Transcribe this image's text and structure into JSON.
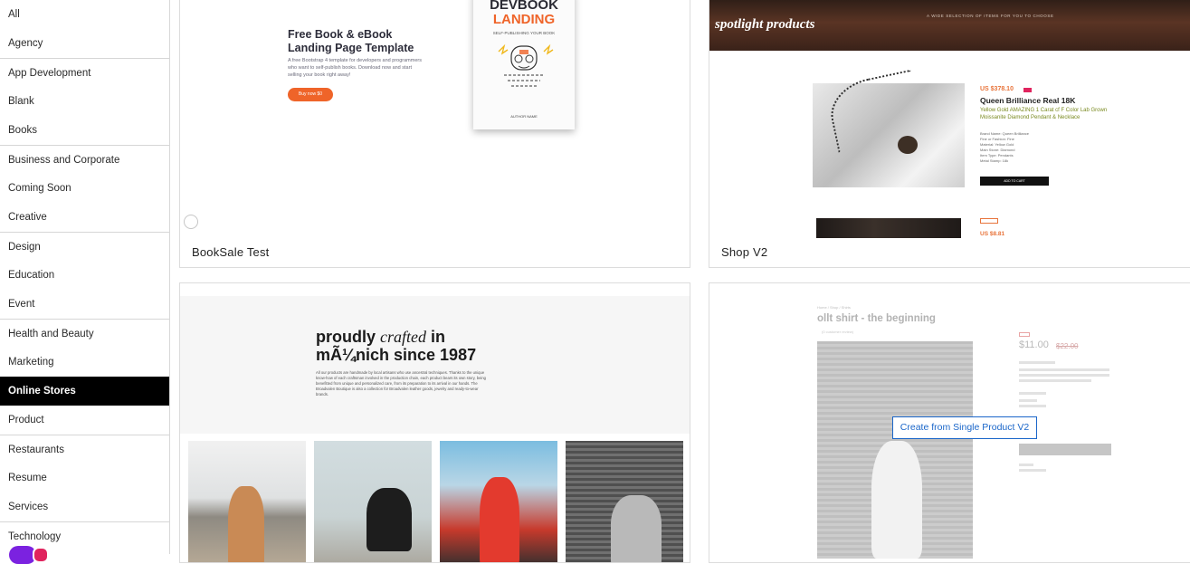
{
  "sidebar": {
    "items": [
      {
        "label": "All"
      },
      {
        "label": "Agency"
      },
      {
        "label": "App Development"
      },
      {
        "label": "Blank"
      },
      {
        "label": "Books"
      },
      {
        "label": "Business and Corporate"
      },
      {
        "label": "Coming Soon"
      },
      {
        "label": "Creative"
      },
      {
        "label": "Design"
      },
      {
        "label": "Education"
      },
      {
        "label": "Event"
      },
      {
        "label": "Health and Beauty"
      },
      {
        "label": "Marketing"
      },
      {
        "label": "Online Stores",
        "active": true
      },
      {
        "label": "Product"
      },
      {
        "label": "Restaurants"
      },
      {
        "label": "Resume"
      },
      {
        "label": "Services"
      },
      {
        "label": "Technology"
      }
    ]
  },
  "templates": [
    {
      "name": "BookSale Test",
      "preview": {
        "title_line1": "Free Book & eBook",
        "title_line2": "Landing Page Template",
        "description": "A free Bootstrap 4 template for developers and programmers who want to self-publish books. Download now and start selling your book right away!",
        "button": "Buy now $0",
        "book_title_1": "DEVBOOK",
        "book_title_2": "LANDING",
        "book_subtitle": "SELF-PUBLISHING YOUR BOOK",
        "book_author": "AUTHOR NAME"
      }
    },
    {
      "name": "Shop V2",
      "preview": {
        "banner": "spotlight products",
        "banner_small": "A WIDE SELECTION OF ITEMS FOR YOU TO CHOOSE",
        "price": "US $378.10",
        "product_name": "Queen Brilliance Real 18K",
        "product_sub": "Yellow Gold AMAZING 1 Carat cf F Color Lab Grown Moissanite Diamond Pendant & Necklace",
        "specs": [
          "Brand Name: Queen Brilliance",
          "Fine or Fashion: Fine",
          "Material: Yellow Gold",
          "Main Stone: Diamond",
          "Item Type: Pendants",
          "Metal Stamp: 18k"
        ],
        "button": "ADD TO CART",
        "price2": "US $8.81"
      }
    },
    {
      "name": "",
      "preview": {
        "headline_a": "proudly ",
        "headline_b": "crafted",
        "headline_c": " in",
        "headline_line2": "mÃ¼nich since 1987",
        "body": "All our products are handmade by local artisans who use ancestral techniques. Thanks to the unique know-how of each craftsman involved in the production chain, each product bears its own story, being benefitted from unique and personalized care, from its preparation to its arrival in our hands. The Broadvalen Boutique is also a collection for Broadvalen leather goods, jewelry and ready-to-wear brands."
      }
    },
    {
      "name": "",
      "preview": {
        "breadcrumb": "Home / Shop / Shirts",
        "title": "ollt shirt - the beginning",
        "reviews": "(0 customer review)",
        "price": "$11.00",
        "old_price": "$22.00"
      },
      "hover_action": "Create from Single Product V2"
    }
  ],
  "colors": {
    "active_bg": "#000000",
    "accent_orange": "#ef6429",
    "link_blue": "#1a66c9"
  }
}
